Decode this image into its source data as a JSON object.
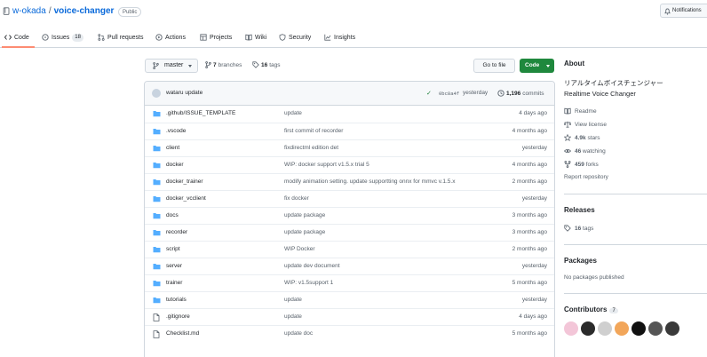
{
  "repo": {
    "owner": "w-okada",
    "separator": "/",
    "name": "voice-changer",
    "visibility": "Public",
    "notifications_label": "Notifications"
  },
  "tabs": [
    {
      "label": "Code",
      "icon": "code-icon"
    },
    {
      "label": "Issues",
      "count": "18",
      "icon": "issue-icon"
    },
    {
      "label": "Pull requests",
      "icon": "pull-request-icon"
    },
    {
      "label": "Actions",
      "icon": "play-icon"
    },
    {
      "label": "Projects",
      "icon": "table-icon"
    },
    {
      "label": "Wiki",
      "icon": "book-icon"
    },
    {
      "label": "Security",
      "icon": "shield-icon"
    },
    {
      "label": "Insights",
      "icon": "graph-icon"
    }
  ],
  "toolbar": {
    "branch": "master",
    "branches_count": "7",
    "branches_label": "branches",
    "tags_count": "16",
    "tags_label": "tags",
    "goto_file": "Go to file",
    "code_button": "Code"
  },
  "commit": {
    "author": "wataru",
    "message": "update",
    "check": "✓",
    "sha": "0bc8a4f",
    "time": "yesterday",
    "count": "1,196",
    "count_label": "commits"
  },
  "files": [
    {
      "type": "folder",
      "name": ".github/ISSUE_TEMPLATE",
      "message": "update",
      "age": "4 days ago"
    },
    {
      "type": "folder",
      "name": ".vscode",
      "message": "first commit of recorder",
      "age": "4 months ago"
    },
    {
      "type": "folder",
      "name": "client",
      "message": "fixdirectml edition det",
      "age": "yesterday"
    },
    {
      "type": "folder",
      "name": "docker",
      "message": "WIP: docker support v1.5.x trial 5",
      "age": "4 months ago"
    },
    {
      "type": "folder",
      "name": "docker_trainer",
      "message": "modify animation setting. update supportting onnx for mmvc v.1.5.x",
      "age": "2 months ago"
    },
    {
      "type": "folder",
      "name": "docker_vcclient",
      "message": "fix docker",
      "age": "yesterday"
    },
    {
      "type": "folder",
      "name": "docs",
      "message": "update package",
      "age": "3 months ago"
    },
    {
      "type": "folder",
      "name": "recorder",
      "message": "update package",
      "age": "3 months ago"
    },
    {
      "type": "folder",
      "name": "script",
      "message": "WIP Docker",
      "age": "2 months ago"
    },
    {
      "type": "folder",
      "name": "server",
      "message": "update dev document",
      "age": "yesterday"
    },
    {
      "type": "folder",
      "name": "trainer",
      "message": "WIP: v1.5support 1",
      "age": "5 months ago"
    },
    {
      "type": "folder",
      "name": "tutorials",
      "message": "update",
      "age": "yesterday"
    },
    {
      "type": "file",
      "name": ".gitignore",
      "message": "update",
      "age": "4 days ago"
    },
    {
      "type": "file",
      "name": "Checklist.md",
      "message": "update doc",
      "age": "5 months ago"
    }
  ],
  "about": {
    "heading": "About",
    "description_jp": "リアルタイムボイスチェンジャー",
    "description_en": "Realtime Voice Changer",
    "readme": "Readme",
    "license": "View license",
    "stars_count": "4.9k",
    "stars_label": "stars",
    "watching_count": "46",
    "watching_label": "watching",
    "forks_count": "459",
    "forks_label": "forks",
    "report": "Report repository"
  },
  "releases": {
    "heading": "Releases",
    "tags_count": "16",
    "tags_label": "tags"
  },
  "packages": {
    "heading": "Packages",
    "text": "No packages published"
  },
  "contributors": {
    "heading": "Contributors",
    "count": "7",
    "avatar_colors": [
      "#f3c6d8",
      "#2b2b2b",
      "#cfcfcf",
      "#f2a65a",
      "#111111",
      "#555555",
      "#3a3a3a"
    ]
  },
  "colors": {
    "accent": "#0969da",
    "folder": "#54aeff",
    "code_button": "#1f883d",
    "tab_underline": "#fd8c73"
  }
}
